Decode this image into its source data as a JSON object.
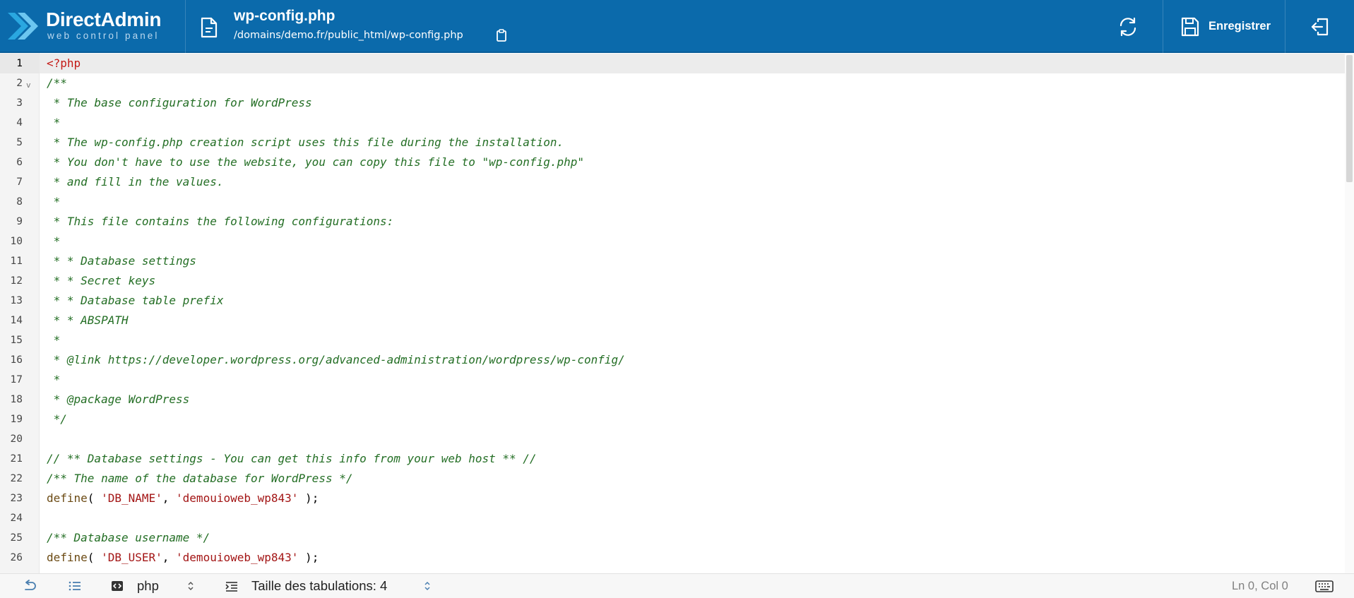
{
  "brand": {
    "name": "DirectAdmin",
    "tagline": "web control panel"
  },
  "file": {
    "name": "wp-config.php",
    "path": "/domains/demo.fr/public_html/wp-config.php"
  },
  "toolbar": {
    "save_label": "Enregistrer"
  },
  "editor": {
    "active_line": 1,
    "lines": [
      {
        "n": "1",
        "tokens": [
          {
            "c": "meta",
            "t": "<?php"
          }
        ]
      },
      {
        "n": "2",
        "fold": true,
        "tokens": [
          {
            "c": "comment",
            "t": "/**"
          }
        ]
      },
      {
        "n": "3",
        "tokens": [
          {
            "c": "comment",
            "t": " * The base configuration for WordPress"
          }
        ]
      },
      {
        "n": "4",
        "tokens": [
          {
            "c": "comment",
            "t": " *"
          }
        ]
      },
      {
        "n": "5",
        "tokens": [
          {
            "c": "comment",
            "t": " * The wp-config.php creation script uses this file during the installation."
          }
        ]
      },
      {
        "n": "6",
        "tokens": [
          {
            "c": "comment",
            "t": " * You don't have to use the website, you can copy this file to \"wp-config.php\""
          }
        ]
      },
      {
        "n": "7",
        "tokens": [
          {
            "c": "comment",
            "t": " * and fill in the values."
          }
        ]
      },
      {
        "n": "8",
        "tokens": [
          {
            "c": "comment",
            "t": " *"
          }
        ]
      },
      {
        "n": "9",
        "tokens": [
          {
            "c": "comment",
            "t": " * This file contains the following configurations:"
          }
        ]
      },
      {
        "n": "10",
        "tokens": [
          {
            "c": "comment",
            "t": " *"
          }
        ]
      },
      {
        "n": "11",
        "tokens": [
          {
            "c": "comment",
            "t": " * * Database settings"
          }
        ]
      },
      {
        "n": "12",
        "tokens": [
          {
            "c": "comment",
            "t": " * * Secret keys"
          }
        ]
      },
      {
        "n": "13",
        "tokens": [
          {
            "c": "comment",
            "t": " * * Database table prefix"
          }
        ]
      },
      {
        "n": "14",
        "tokens": [
          {
            "c": "comment",
            "t": " * * ABSPATH"
          }
        ]
      },
      {
        "n": "15",
        "tokens": [
          {
            "c": "comment",
            "t": " *"
          }
        ]
      },
      {
        "n": "16",
        "tokens": [
          {
            "c": "comment",
            "t": " * @link https://developer.wordpress.org/advanced-administration/wordpress/wp-config/"
          }
        ]
      },
      {
        "n": "17",
        "tokens": [
          {
            "c": "comment",
            "t": " *"
          }
        ]
      },
      {
        "n": "18",
        "tokens": [
          {
            "c": "comment",
            "t": " * @package WordPress"
          }
        ]
      },
      {
        "n": "19",
        "tokens": [
          {
            "c": "comment",
            "t": " */"
          }
        ]
      },
      {
        "n": "20",
        "tokens": []
      },
      {
        "n": "21",
        "tokens": [
          {
            "c": "comment",
            "t": "// ** Database settings - You can get this info from your web host ** //"
          }
        ]
      },
      {
        "n": "22",
        "tokens": [
          {
            "c": "comment",
            "t": "/** The name of the database for WordPress */"
          }
        ]
      },
      {
        "n": "23",
        "tokens": [
          {
            "c": "fn",
            "t": "define"
          },
          {
            "c": "punc",
            "t": "( "
          },
          {
            "c": "str",
            "t": "'DB_NAME'"
          },
          {
            "c": "punc",
            "t": ", "
          },
          {
            "c": "str",
            "t": "'demouioweb_wp843'"
          },
          {
            "c": "punc",
            "t": " );"
          }
        ]
      },
      {
        "n": "24",
        "tokens": []
      },
      {
        "n": "25",
        "tokens": [
          {
            "c": "comment",
            "t": "/** Database username */"
          }
        ]
      },
      {
        "n": "26",
        "tokens": [
          {
            "c": "fn",
            "t": "define"
          },
          {
            "c": "punc",
            "t": "( "
          },
          {
            "c": "str",
            "t": "'DB_USER'"
          },
          {
            "c": "punc",
            "t": ", "
          },
          {
            "c": "str",
            "t": "'demouioweb_wp843'"
          },
          {
            "c": "punc",
            "t": " );"
          }
        ]
      }
    ]
  },
  "statusbar": {
    "language": "php",
    "tab_size_label": "Taille des tabulations: 4",
    "cursor_position": "Ln 0, Col 0"
  },
  "colors": {
    "header_bg": "#0b6aab",
    "logo_accent": "#2aa7e0",
    "comment": "#236e24",
    "string": "#a31515",
    "php_tag": "#c41a16",
    "function": "#6b4a13"
  },
  "icons": {
    "logo": "directadmin-logo-icon",
    "file": "file-icon",
    "copy": "clipboard-icon",
    "reload": "reload-icon",
    "save": "floppy-disk-icon",
    "logout": "logout-icon",
    "undo": "undo-icon",
    "list": "list-icon",
    "language": "code-icon",
    "tabs": "indent-icon",
    "keyboard": "keyboard-icon"
  }
}
